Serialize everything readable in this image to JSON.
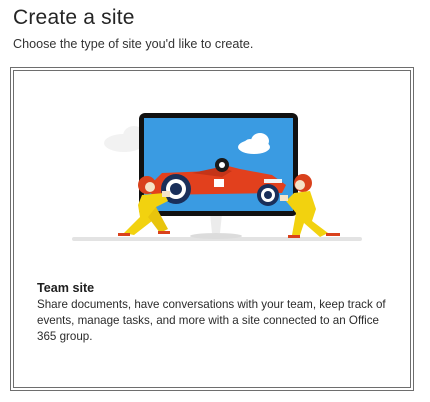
{
  "header": {
    "title": "Create a site",
    "subtitle": "Choose the type of site you'd like to create."
  },
  "site_option": {
    "title": "Team site",
    "description": "Share documents, have conversations with your team, keep track of events, manage tasks, and more with a site connected to an Office 365 group.",
    "illustration": "team-site-illustration"
  },
  "colors": {
    "sky": "#3a9be2",
    "race_car": "#e2401d",
    "worker_suit": "#f2d20f",
    "helmet": "#d9411c",
    "monitor_frame": "#111111"
  }
}
